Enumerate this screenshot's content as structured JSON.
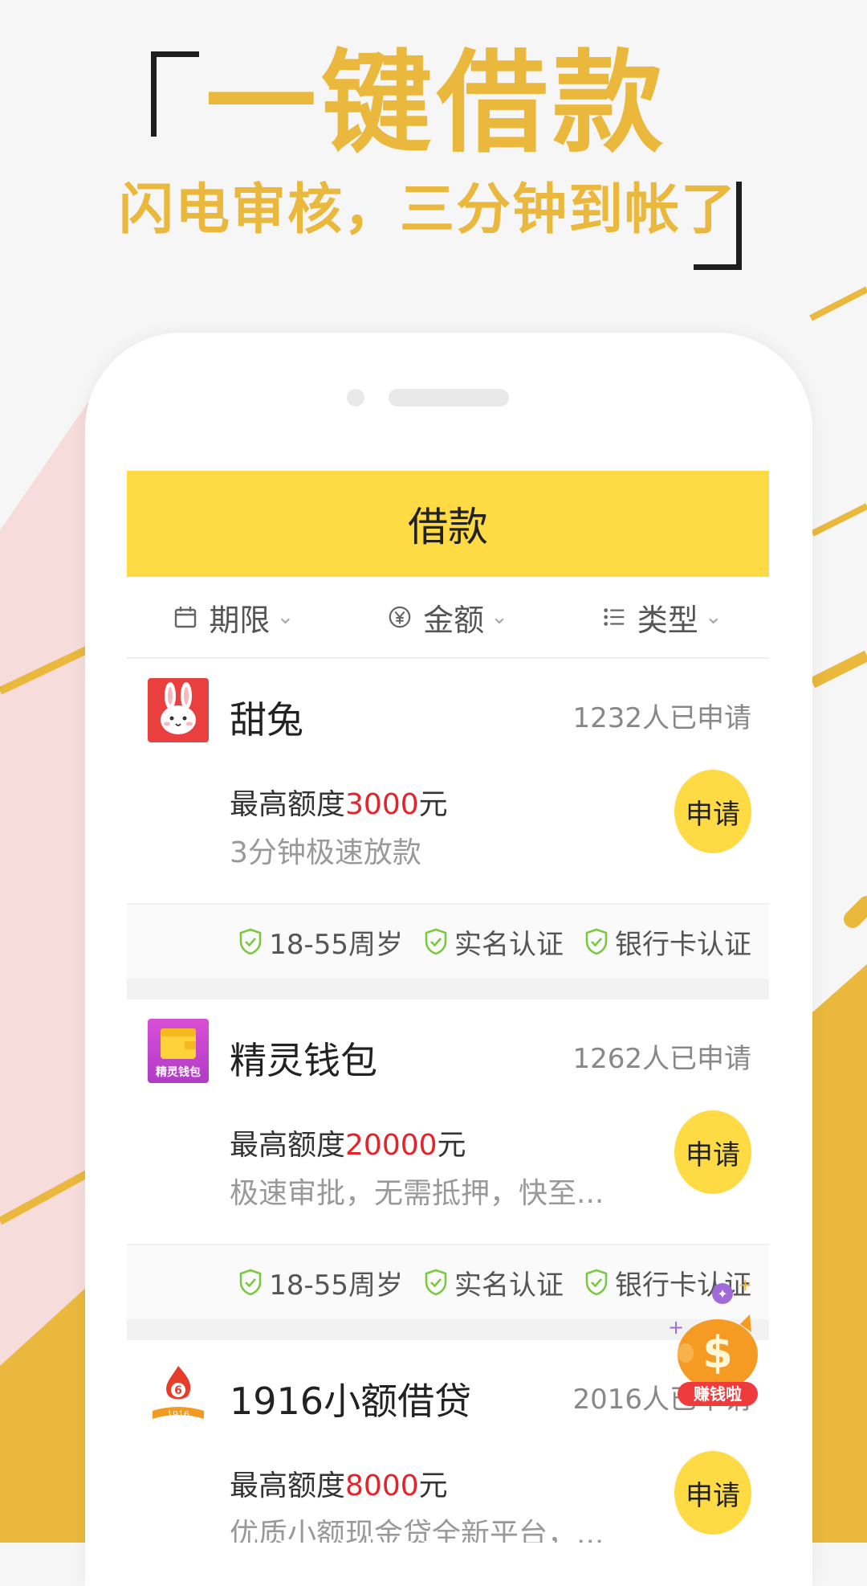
{
  "promo": {
    "title": "一键借款",
    "subtitle": "闪电审核，三分钟到帐了"
  },
  "app": {
    "title": "借款",
    "filters": [
      {
        "icon": "calendar-icon",
        "label": "期限"
      },
      {
        "icon": "yen-icon",
        "label": "金额"
      },
      {
        "icon": "list-icon",
        "label": "类型"
      }
    ],
    "loans": [
      {
        "name": "甜兔",
        "applied": "1232人已申请",
        "limit_prefix": "最高额度",
        "limit_amount": "3000",
        "limit_suffix": "元",
        "desc": "3分钟极速放款",
        "button": "申请",
        "tags": [
          "18-55周岁",
          "实名认证",
          "银行卡认证"
        ]
      },
      {
        "name": "精灵钱包",
        "logo_text": "精灵钱包",
        "applied": "1262人已申请",
        "limit_prefix": "最高额度",
        "limit_amount": "20000",
        "limit_suffix": "元",
        "desc": " 极速审批，无需抵押，快至...",
        "button": "申请",
        "tags": [
          "18-55周岁",
          "实名认证",
          "银行卡认证"
        ]
      },
      {
        "name": "1916小额借贷",
        "logo_text": "1916",
        "applied": "2016人已申请",
        "limit_prefix": "最高额度",
        "limit_amount": "8000",
        "limit_suffix": "元",
        "desc": "优质小额现金贷全新平台，...",
        "button": "申请"
      }
    ],
    "floating_badge": "赚钱啦"
  },
  "colors": {
    "brand_yellow": "#fedb44",
    "hero_gold": "#e9b83d",
    "amount_red": "#e3242b",
    "shield_green": "#7ac943"
  }
}
